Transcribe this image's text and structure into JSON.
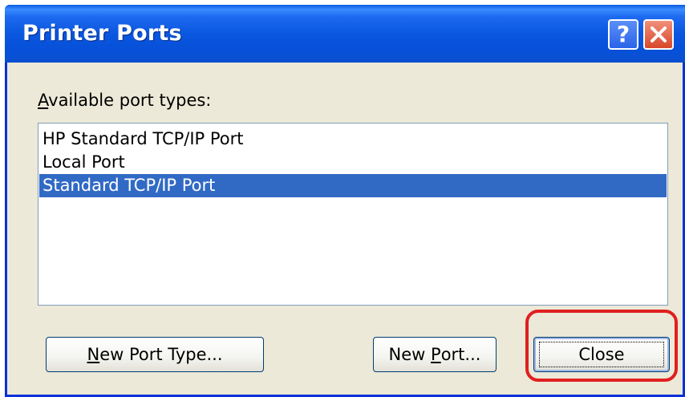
{
  "window": {
    "title": "Printer Ports",
    "help_glyph": "?",
    "close_icon": "close-x-icon"
  },
  "label": {
    "mnemonic": "A",
    "rest": "vailable port types:"
  },
  "list": {
    "items": [
      "HP Standard TCP/IP Port",
      "Local Port",
      "Standard TCP/IP Port"
    ],
    "selected_index": 2
  },
  "buttons": {
    "new_port_type": {
      "mnemonic": "N",
      "rest": "ew Port Type..."
    },
    "new_port": {
      "pre": "New ",
      "mnemonic": "P",
      "rest": "ort..."
    },
    "close": "Close"
  },
  "colors": {
    "titlebar": "#0a57e0",
    "selection": "#316ac5",
    "highlight_ring": "#e02020",
    "dialog_bg": "#ece9d8"
  }
}
